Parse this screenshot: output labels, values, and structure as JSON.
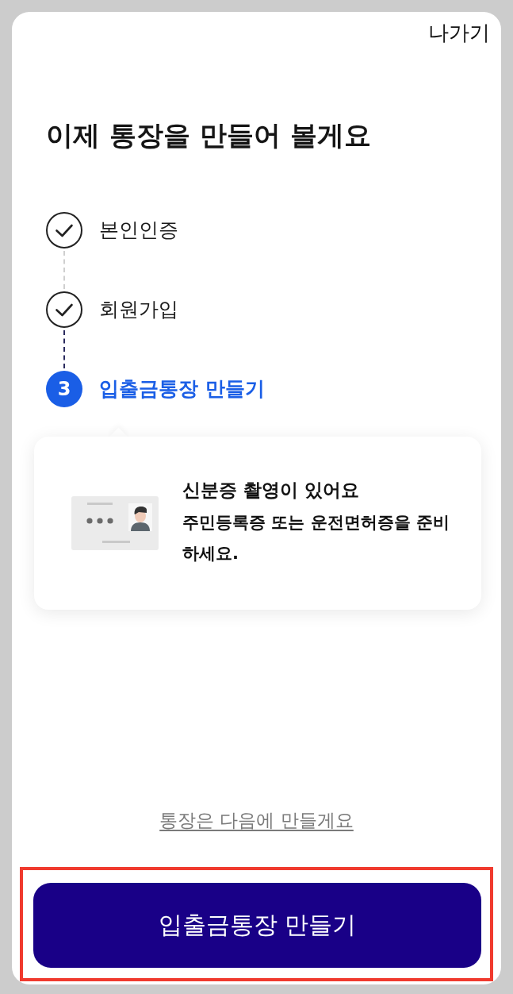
{
  "header": {
    "exit_label": "나가기"
  },
  "title": "이제 통장을 만들어 볼게요",
  "steps": [
    {
      "label": "본인인증",
      "kind": "done"
    },
    {
      "label": "회원가입",
      "kind": "done"
    },
    {
      "label": "입출금통장 만들기",
      "kind": "current",
      "number": "3"
    }
  ],
  "notice": {
    "title": "신분증 촬영이 있어요",
    "body": "주민등록증 또는 운전면허증을 준비하세요."
  },
  "skip_link": "통장은 다음에 만들게요",
  "primary_button": {
    "label": "입출금통장 만들기",
    "highlighted": true
  }
}
